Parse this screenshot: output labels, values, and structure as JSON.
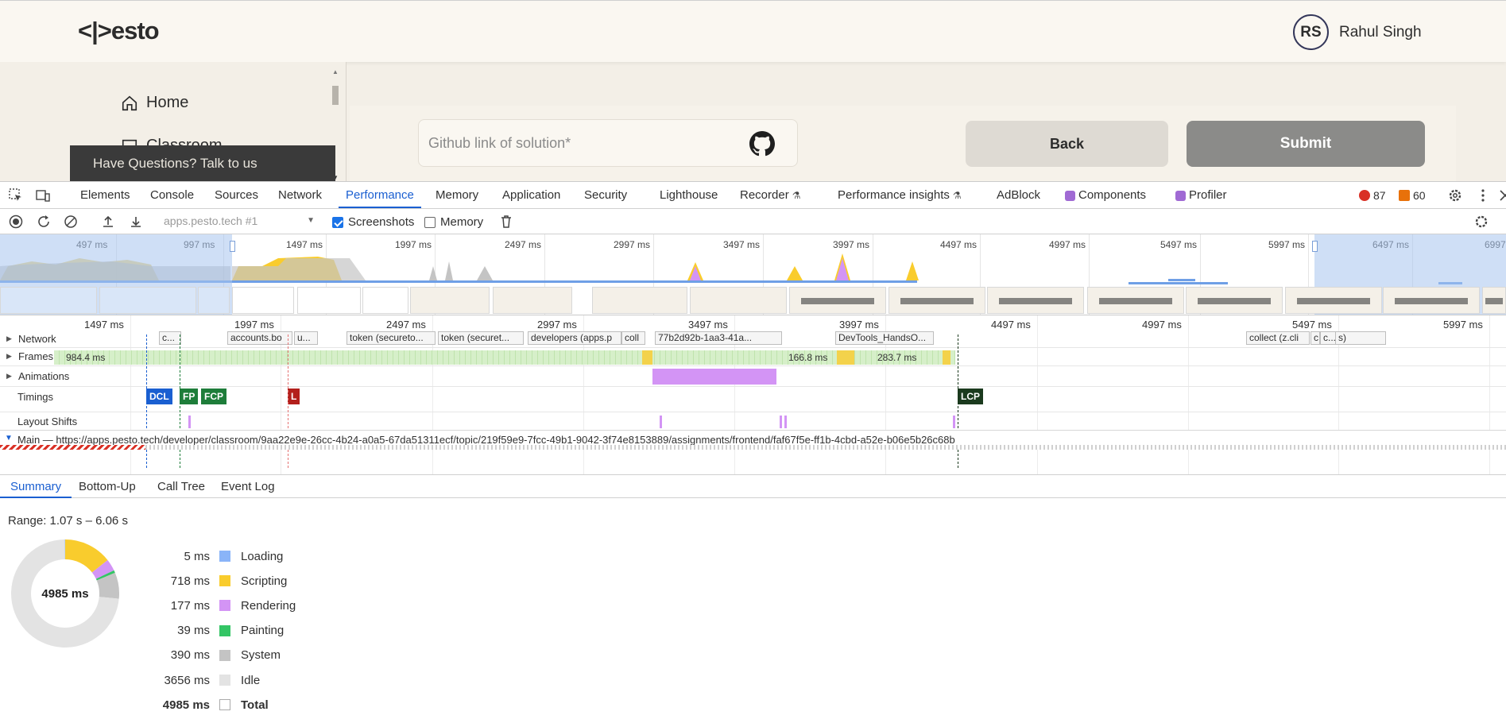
{
  "app": {
    "logo": "<|>esto",
    "user": {
      "initials": "RS",
      "name": "Rahul Singh"
    },
    "sidebar": {
      "items": [
        {
          "label": "Home",
          "icon": "home-icon"
        },
        {
          "label": "Classroom",
          "icon": "classroom-icon"
        }
      ]
    },
    "questions_banner": "Have Questions? Talk to us",
    "github_input": {
      "placeholder": "Github link of solution*",
      "value": ""
    },
    "back_label": "Back",
    "submit_label": "Submit"
  },
  "devtools": {
    "tabs": [
      {
        "label": "Elements"
      },
      {
        "label": "Console"
      },
      {
        "label": "Sources"
      },
      {
        "label": "Network"
      },
      {
        "label": "Performance",
        "active": true
      },
      {
        "label": "Memory"
      },
      {
        "label": "Application"
      },
      {
        "label": "Security"
      },
      {
        "label": "Lighthouse"
      },
      {
        "label": "Recorder"
      },
      {
        "label": "Performance insights"
      },
      {
        "label": "AdBlock"
      },
      {
        "label": "Components"
      },
      {
        "label": "Profiler"
      }
    ],
    "error_count": "87",
    "warning_count": "60",
    "toolbar": {
      "profile": "apps.pesto.tech #1",
      "screenshots_label": "Screenshots",
      "screenshots_checked": true,
      "memory_label": "Memory",
      "memory_checked": false
    },
    "overview_ticks": [
      "497 ms",
      "997 ms",
      "1497 ms",
      "1997 ms",
      "2497 ms",
      "2997 ms",
      "3497 ms",
      "3997 ms",
      "4497 ms",
      "4997 ms",
      "5497 ms",
      "5997 ms",
      "6497 ms",
      "6997"
    ],
    "timeline_ticks": [
      "1497 ms",
      "1997 ms",
      "2497 ms",
      "2997 ms",
      "3497 ms",
      "3997 ms",
      "4497 ms",
      "4997 ms",
      "5497 ms",
      "5997 ms"
    ],
    "tracks": {
      "network": "Network",
      "frames": "Frames",
      "animations": "Animations",
      "timings": "Timings",
      "layout_shifts": "Layout Shifts",
      "main": "Main — https://apps.pesto.tech/developer/classroom/9aa22e9e-26cc-4b24-a0a5-67da51311ecf/topic/219f59e9-7fcc-49b1-9042-3f74e8153889/assignments/frontend/faf67f5e-ff1b-4cbd-a52e-b06e5b26c68b"
    },
    "network_requests": [
      "c...",
      "accounts.bo",
      "u...",
      "token (secureto...",
      "token (securet...",
      "developers (apps.p",
      "coll",
      "77b2d92b-1aa3-41a...",
      "DevTools_HandsO...",
      "collect (z.cli",
      "c",
      "c...",
      "s)"
    ],
    "frames": {
      "first": "984.4 ms",
      "second": "166.8 ms",
      "third": "283.7 ms"
    },
    "timings": [
      "DCL",
      "FP",
      "FCP",
      "L",
      "LCP"
    ],
    "bottom_tabs": [
      {
        "label": "Summary",
        "active": true
      },
      {
        "label": "Bottom-Up"
      },
      {
        "label": "Call Tree"
      },
      {
        "label": "Event Log"
      }
    ],
    "summary": {
      "range": "Range: 1.07 s – 6.06 s",
      "total_label": "4985 ms",
      "rows": [
        {
          "value": "5 ms",
          "label": "Loading",
          "color": "#8ab4f8",
          "ms": 5
        },
        {
          "value": "718 ms",
          "label": "Scripting",
          "color": "#f9cc2d",
          "ms": 718
        },
        {
          "value": "177 ms",
          "label": "Rendering",
          "color": "#d394f5",
          "ms": 177
        },
        {
          "value": "39 ms",
          "label": "Painting",
          "color": "#34c565",
          "ms": 39
        },
        {
          "value": "390 ms",
          "label": "System",
          "color": "#c4c4c4",
          "ms": 390
        },
        {
          "value": "3656 ms",
          "label": "Idle",
          "color": "#e3e3e3",
          "ms": 3656
        }
      ],
      "total": {
        "value": "4985 ms",
        "label": "Total"
      }
    }
  }
}
